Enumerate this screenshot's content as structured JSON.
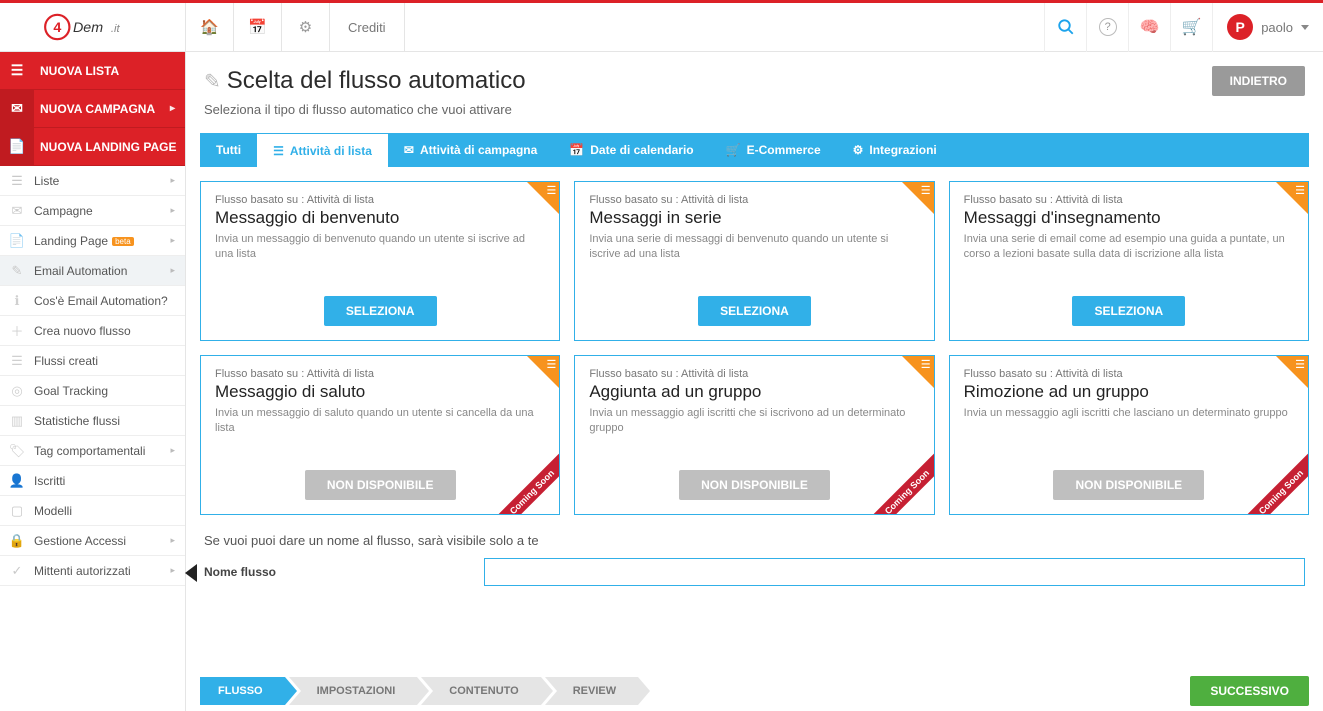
{
  "topbar": {
    "brand": "4Dem.it",
    "crediti": "Crediti",
    "user_initial": "P",
    "user_name": "paolo"
  },
  "sidebar": {
    "primary": [
      {
        "label": "NUOVA LISTA",
        "icon": "☰"
      },
      {
        "label": "NUOVA CAMPAGNA",
        "icon": "✉",
        "arrow": true
      },
      {
        "label": "NUOVA LANDING PAGE",
        "icon": "📄"
      }
    ],
    "menu": [
      {
        "label": "Liste",
        "icon": "☰",
        "arrow": true
      },
      {
        "label": "Campagne",
        "icon": "✉",
        "arrow": true
      },
      {
        "label": "Landing Page",
        "icon": "📄",
        "arrow": true,
        "beta": "beta"
      },
      {
        "label": "Email Automation",
        "icon": "✎",
        "arrow": true,
        "active": true
      },
      {
        "label": "Cos'è Email Automation?",
        "icon": "ℹ",
        "sub": true
      },
      {
        "label": "Crea nuovo flusso",
        "icon": "＋",
        "sub": true
      },
      {
        "label": "Flussi creati",
        "icon": "☰",
        "sub": true
      },
      {
        "label": "Goal Tracking",
        "icon": "◎",
        "sub": true
      },
      {
        "label": "Statistiche flussi",
        "icon": "▥",
        "sub": true
      },
      {
        "label": "Tag comportamentali",
        "icon": "🏷",
        "arrow": true
      },
      {
        "label": "Iscritti",
        "icon": "👤"
      },
      {
        "label": "Modelli",
        "icon": "▢"
      },
      {
        "label": "Gestione Accessi",
        "icon": "🔒",
        "arrow": true
      },
      {
        "label": "Mittenti autorizzati",
        "icon": "✓",
        "arrow": true
      }
    ]
  },
  "page": {
    "title": "Scelta del flusso automatico",
    "subtitle": "Seleziona il tipo di flusso automatico che vuoi attivare",
    "back": "INDIETRO"
  },
  "tabs": [
    {
      "label": "Tutti",
      "icon": ""
    },
    {
      "label": "Attività di lista",
      "icon": "☰",
      "active": true
    },
    {
      "label": "Attività di campagna",
      "icon": "✉"
    },
    {
      "label": "Date di calendario",
      "icon": "📅"
    },
    {
      "label": "E-Commerce",
      "icon": "🛒"
    },
    {
      "label": "Integrazioni",
      "icon": "⚙"
    }
  ],
  "cards": [
    {
      "eyebrow": "Flusso basato su : Attività di lista",
      "title": "Messaggio di benvenuto",
      "desc": "Invia un messaggio di benvenuto quando un utente si iscrive ad una lista",
      "btn": "SELEZIONA",
      "available": true
    },
    {
      "eyebrow": "Flusso basato su : Attività di lista",
      "title": "Messaggi in serie",
      "desc": "Invia una serie di messaggi di benvenuto quando un utente si iscrive ad una lista",
      "btn": "SELEZIONA",
      "available": true
    },
    {
      "eyebrow": "Flusso basato su : Attività di lista",
      "title": "Messaggi d'insegnamento",
      "desc": "Invia una serie di email come ad esempio una guida a puntate, un corso a lezioni basate sulla data di iscrizione alla lista",
      "btn": "SELEZIONA",
      "available": true
    },
    {
      "eyebrow": "Flusso basato su : Attività di lista",
      "title": "Messaggio di saluto",
      "desc": "Invia un messaggio di saluto quando un utente si cancella da una lista",
      "btn": "NON DISPONIBILE",
      "available": false,
      "ribbon": "Coming Soon"
    },
    {
      "eyebrow": "Flusso basato su : Attività di lista",
      "title": "Aggiunta ad un gruppo",
      "desc": "Invia un messaggio agli iscritti che si iscrivono ad un determinato gruppo",
      "btn": "NON DISPONIBILE",
      "available": false,
      "ribbon": "Coming Soon"
    },
    {
      "eyebrow": "Flusso basato su : Attività di lista",
      "title": "Rimozione ad un gruppo",
      "desc": "Invia un messaggio agli iscritti che lasciano un determinato gruppo",
      "btn": "NON DISPONIBILE",
      "available": false,
      "ribbon": "Coming Soon"
    }
  ],
  "name_section": {
    "hint": "Se vuoi puoi dare un nome al flusso, sarà visibile solo a te",
    "label": "Nome flusso",
    "value": ""
  },
  "wizard": {
    "steps": [
      "FLUSSO",
      "IMPOSTAZIONI",
      "CONTENUTO",
      "REVIEW"
    ],
    "active": 0,
    "next": "SUCCESSIVO"
  }
}
